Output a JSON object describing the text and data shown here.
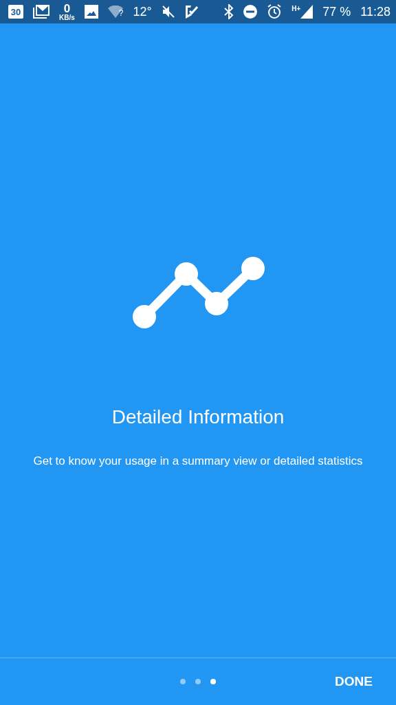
{
  "status_bar": {
    "left": [
      {
        "kind": "calendar",
        "text": "30"
      },
      {
        "kind": "mail"
      },
      {
        "kind": "speed",
        "value": "0",
        "unit": "KB/s"
      },
      {
        "kind": "image"
      },
      {
        "kind": "wifi",
        "text": "?"
      },
      {
        "kind": "text",
        "text": "12°"
      },
      {
        "kind": "mute"
      },
      {
        "kind": "check"
      }
    ],
    "right": [
      {
        "kind": "bluetooth"
      },
      {
        "kind": "dnd"
      },
      {
        "kind": "alarm"
      },
      {
        "kind": "signal",
        "text": "H+"
      },
      {
        "kind": "text",
        "text": "77 %"
      },
      {
        "kind": "text",
        "text": "11:28"
      }
    ]
  },
  "slide": {
    "title": "Detailed Information",
    "description": "Get to know your usage in a summary view or detailed statistics"
  },
  "pager": [
    {
      "selected": false
    },
    {
      "selected": false
    },
    {
      "selected": true
    }
  ],
  "done_button": "DONE"
}
